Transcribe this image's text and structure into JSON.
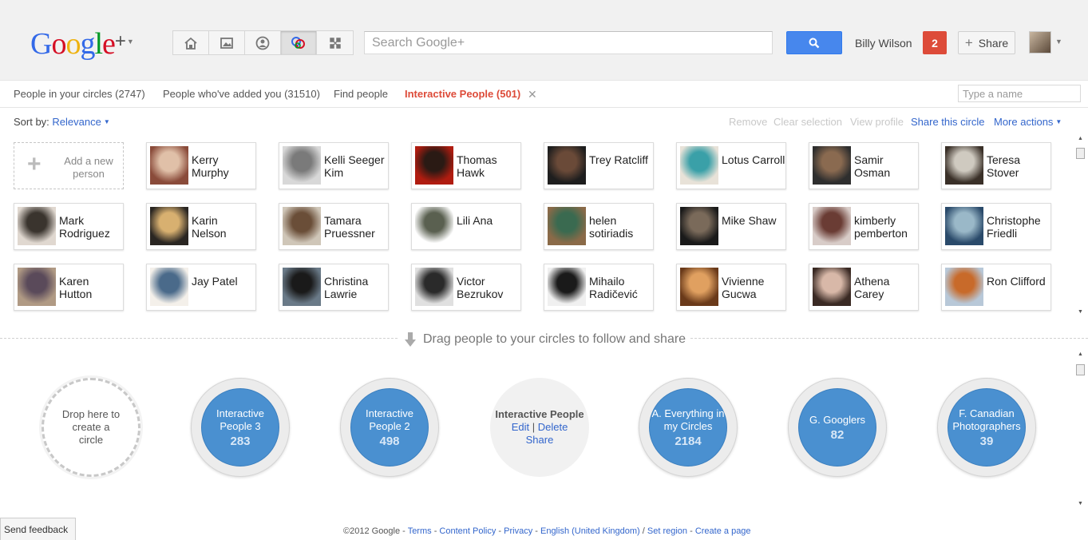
{
  "header": {
    "logo_text": "Google+",
    "search_placeholder": "Search Google+",
    "username": "Billy Wilson",
    "notifications": "2",
    "share_label": "Share"
  },
  "nav_icons": [
    "home-icon",
    "photos-icon",
    "profile-icon",
    "circles-icon",
    "games-icon"
  ],
  "tabs": {
    "circles": "People in your circles (2747)",
    "added_you": "People who've added you (31510)",
    "find": "Find people",
    "active": "Interactive People (501)"
  },
  "name_filter_placeholder": "Type a name",
  "sort": {
    "label": "Sort by:",
    "value": "Relevance"
  },
  "actions": {
    "remove": "Remove",
    "clear_selection": "Clear selection",
    "view_profile": "View profile",
    "share_circle": "Share this circle",
    "more_actions": "More actions"
  },
  "add_person": "Add a new person",
  "people": [
    {
      "name": "Kerry Murphy",
      "c1": "#8a4b3a",
      "c2": "#e0c0a8"
    },
    {
      "name": "Kelli Seeger Kim",
      "c1": "#d8d8d8",
      "c2": "#7a7a7a"
    },
    {
      "name": "Thomas Hawk",
      "c1": "#b01c10",
      "c2": "#2a1a14"
    },
    {
      "name": "Trey Ratcliff",
      "c1": "#1e1e1e",
      "c2": "#6a4a38"
    },
    {
      "name": "Lotus Carroll",
      "c1": "#e8e2d8",
      "c2": "#3aa0a8"
    },
    {
      "name": "Samir Osman",
      "c1": "#2e2e2e",
      "c2": "#8a6a50"
    },
    {
      "name": "Teresa Stover",
      "c1": "#3a3028",
      "c2": "#cfcac0"
    },
    {
      "name": "Mark Rodriguez",
      "c1": "#e0d8d0",
      "c2": "#3a342e"
    },
    {
      "name": "Karin Nelson",
      "c1": "#2a2622",
      "c2": "#d8b070"
    },
    {
      "name": "Tamara Pruessner",
      "c1": "#cfc6b8",
      "c2": "#6a4e38"
    },
    {
      "name": "Lili Ana",
      "c1": "#ffffff",
      "c2": "#5a6050"
    },
    {
      "name": "helen sotiriadis",
      "c1": "#8a6a48",
      "c2": "#3a6a50"
    },
    {
      "name": "Mike Shaw",
      "c1": "#1a1a1a",
      "c2": "#7a6a5a"
    },
    {
      "name": "kimberly pemberton",
      "c1": "#d8ccc8",
      "c2": "#6a3c34"
    },
    {
      "name": "Christophe Friedli",
      "c1": "#2a4a6a",
      "c2": "#9ab8c8"
    },
    {
      "name": "Karen Hutton",
      "c1": "#b09a84",
      "c2": "#5a4a5a"
    },
    {
      "name": "Jay Patel",
      "c1": "#f4f0ea",
      "c2": "#4a6a8a"
    },
    {
      "name": "Christina Lawrie",
      "c1": "#6a7a88",
      "c2": "#1a1a1a"
    },
    {
      "name": "Victor Bezrukov",
      "c1": "#e0e0e0",
      "c2": "#2a2a2a"
    },
    {
      "name": "Mihailo Radičević",
      "c1": "#f0f0f0",
      "c2": "#1a1a1a"
    },
    {
      "name": "Vivienne Gucwa",
      "c1": "#6a3a1a",
      "c2": "#e0a060"
    },
    {
      "name": "Athena Carey",
      "c1": "#3a2a24",
      "c2": "#d8b8a8"
    },
    {
      "name": "Ron Clifford",
      "c1": "#b8c8d8",
      "c2": "#c86a2a"
    }
  ],
  "drag_hint": "Drag people to your circles to follow and share",
  "drop_circle": "Drop here to create a circle",
  "circles": [
    {
      "name": "Interactive People 3",
      "count": "283"
    },
    {
      "name": "Interactive People 2",
      "count": "498"
    },
    {
      "name": "A. Everything in my Circles",
      "count": "2184"
    },
    {
      "name": "G. Googlers",
      "count": "82"
    },
    {
      "name": "F. Canadian Photographers",
      "count": "39"
    }
  ],
  "selected_circle": {
    "name": "Interactive People",
    "edit": "Edit",
    "delete": "Delete",
    "share": "Share"
  },
  "footer": {
    "copyright": "©2012 Google - ",
    "terms": "Terms",
    "content_policy": "Content Policy",
    "privacy": "Privacy",
    "language": "English (United Kingdom)",
    "set_region": "Set region",
    "create_page": "Create a page"
  },
  "feedback": "Send feedback",
  "colors": {
    "accent_red": "#dd4b39",
    "link_blue": "#3366cc",
    "circle_blue": "#4a90d0",
    "search_blue": "#4787ed"
  }
}
